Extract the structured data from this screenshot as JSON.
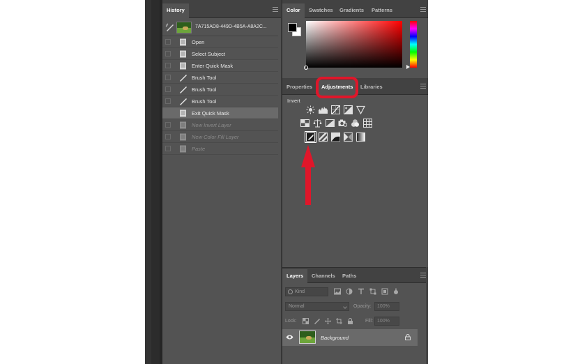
{
  "history_panel": {
    "tab_label": "History",
    "snapshot_name": "7A715AD8-449D-4B5A-A8A2C...",
    "items": [
      {
        "label": "Open",
        "icon": "document-icon",
        "state": "past"
      },
      {
        "label": "Select Subject",
        "icon": "document-icon",
        "state": "past"
      },
      {
        "label": "Enter Quick Mask",
        "icon": "document-icon",
        "state": "past"
      },
      {
        "label": "Brush Tool",
        "icon": "brush-icon",
        "state": "past"
      },
      {
        "label": "Brush Tool",
        "icon": "brush-icon",
        "state": "past"
      },
      {
        "label": "Brush Tool",
        "icon": "brush-icon",
        "state": "past"
      },
      {
        "label": "Exit Quick Mask",
        "icon": "document-icon",
        "state": "selected"
      },
      {
        "label": "New Invert Layer",
        "icon": "document-icon",
        "state": "future"
      },
      {
        "label": "New Color Fill Layer",
        "icon": "document-icon",
        "state": "future"
      },
      {
        "label": "Paste",
        "icon": "document-icon",
        "state": "future"
      }
    ]
  },
  "color_panel": {
    "tabs": [
      "Color",
      "Swatches",
      "Gradients",
      "Patterns"
    ],
    "active_tab": "Color",
    "foreground_color": "#000000",
    "background_color": "#ffffff",
    "hue_color": "#ff0000"
  },
  "adjustments_panel": {
    "tabs": [
      "Properties",
      "Adjustments",
      "Libraries"
    ],
    "active_tab": "Adjustments",
    "hover_label": "Invert",
    "row1_icons": [
      "brightness-contrast-icon",
      "levels-icon",
      "curves-icon",
      "exposure-icon",
      "vibrance-icon"
    ],
    "row2_icons": [
      "hue-saturation-icon",
      "color-balance-icon",
      "black-white-icon",
      "photo-filter-icon",
      "channel-mixer-icon",
      "color-lookup-icon"
    ],
    "row3_icons": [
      "invert-icon",
      "posterize-icon",
      "threshold-icon",
      "selective-color-icon",
      "gradient-map-icon"
    ],
    "annotation_color": "#e0162a"
  },
  "layers_panel": {
    "tabs": [
      "Layers",
      "Channels",
      "Paths"
    ],
    "active_tab": "Layers",
    "filter_kind_placeholder": "Kind",
    "blend_mode": "Normal",
    "opacity_label": "Opacity:",
    "opacity_value": "100%",
    "lock_label": "Lock:",
    "fill_label": "Fill:",
    "fill_value": "100%",
    "layers": [
      {
        "name": "Background",
        "visible": true,
        "locked": true
      }
    ]
  }
}
